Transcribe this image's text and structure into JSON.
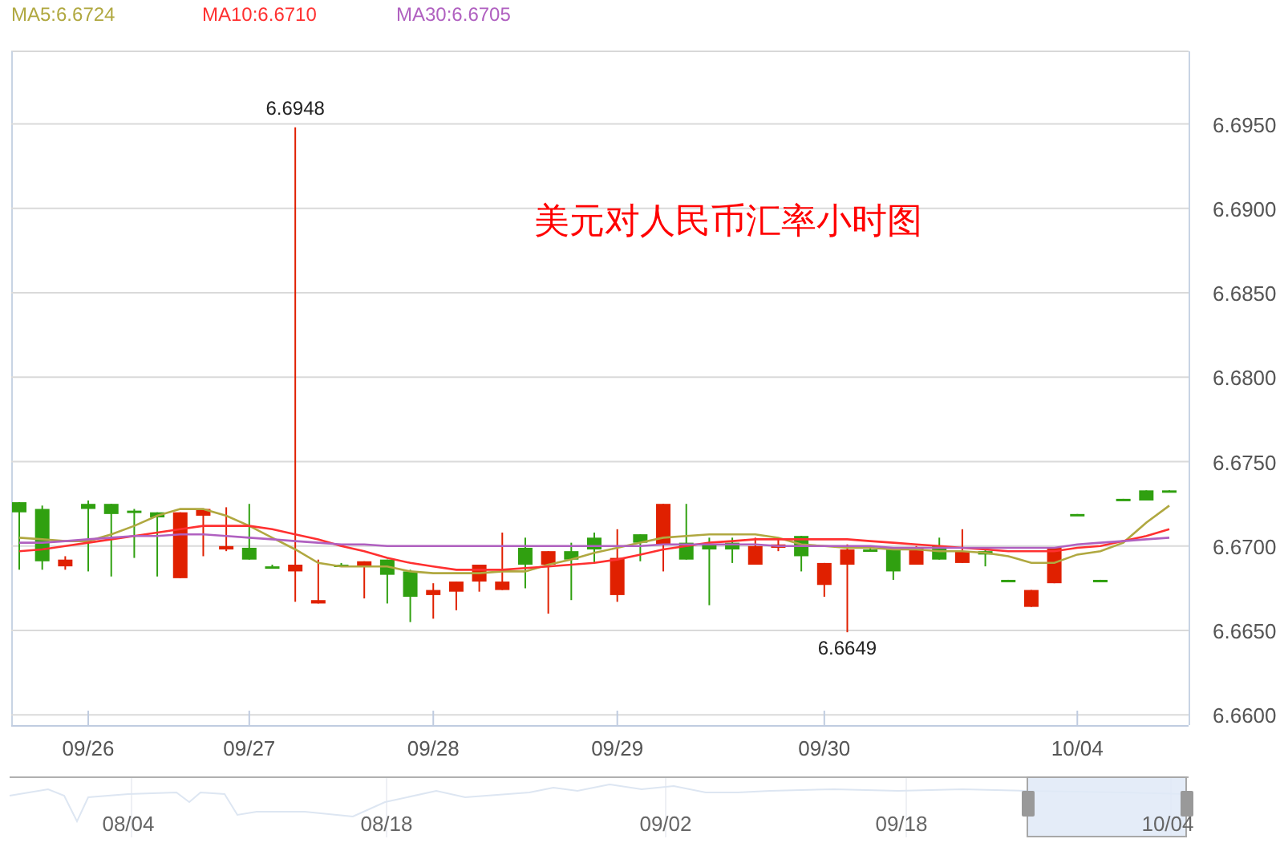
{
  "chart": {
    "chart_data": {
      "type": "candlestick",
      "grid": true,
      "title": "美元对人民币汇率小时图",
      "ylim": [
        6.6594,
        6.6993
      ],
      "yticks": [
        {
          "value": 6.66,
          "label": "6.6600"
        },
        {
          "value": 6.665,
          "label": "6.6650"
        },
        {
          "value": 6.67,
          "label": "6.6700"
        },
        {
          "value": 6.675,
          "label": "6.6750"
        },
        {
          "value": 6.68,
          "label": "6.6800"
        },
        {
          "value": 6.685,
          "label": "6.6850"
        },
        {
          "value": 6.69,
          "label": "6.6900"
        },
        {
          "value": 6.695,
          "label": "6.6950"
        }
      ],
      "categories": [
        null,
        null,
        null,
        "09/26",
        null,
        null,
        null,
        null,
        null,
        null,
        "09/27",
        null,
        null,
        null,
        null,
        null,
        null,
        null,
        "09/28",
        null,
        null,
        null,
        null,
        null,
        null,
        null,
        "09/29",
        null,
        null,
        null,
        null,
        null,
        null,
        null,
        null,
        "09/30",
        null,
        null,
        null,
        null,
        null,
        null,
        null,
        null,
        null,
        null,
        "10/04",
        null,
        null,
        null,
        null
      ],
      "ohlc": [
        [
          6.6726,
          6.6726,
          6.6686,
          6.672
        ],
        [
          6.6722,
          6.6724,
          6.6686,
          6.6691
        ],
        [
          6.6688,
          6.6694,
          6.6686,
          6.6692
        ],
        [
          6.6725,
          6.6727,
          6.6685,
          6.6722
        ],
        [
          6.6725,
          6.6725,
          6.6682,
          6.6719
        ],
        [
          6.6721,
          6.6722,
          6.6693,
          6.672
        ],
        [
          6.672,
          6.672,
          6.6682,
          6.6717
        ],
        [
          6.6681,
          6.672,
          6.6681,
          6.672
        ],
        [
          6.6718,
          6.6722,
          6.6694,
          6.6722
        ],
        [
          6.6698,
          6.6723,
          6.6697,
          6.67
        ],
        [
          6.6699,
          6.6725,
          6.6692,
          6.6692
        ],
        [
          6.6688,
          6.6689,
          6.6687,
          6.6687
        ],
        [
          6.6685,
          6.6948,
          6.6667,
          6.6689
        ],
        [
          6.6666,
          6.6692,
          6.6666,
          6.6668
        ],
        [
          6.6689,
          6.669,
          6.6688,
          6.6688
        ],
        [
          6.6688,
          6.6691,
          6.6669,
          6.6691
        ],
        [
          6.6692,
          6.6692,
          6.6666,
          6.6683
        ],
        [
          6.6685,
          6.6686,
          6.6655,
          6.667
        ],
        [
          6.6671,
          6.6678,
          6.6657,
          6.6674
        ],
        [
          6.6673,
          6.6679,
          6.6662,
          6.6679
        ],
        [
          6.6679,
          6.6689,
          6.6673,
          6.6689
        ],
        [
          6.6674,
          6.6708,
          6.6674,
          6.6679
        ],
        [
          6.6699,
          6.6705,
          6.6675,
          6.6689
        ],
        [
          6.6689,
          6.6697,
          6.666,
          6.6697
        ],
        [
          6.6697,
          6.6702,
          6.6668,
          6.6692
        ],
        [
          6.6705,
          6.6708,
          6.669,
          6.6698
        ],
        [
          6.6671,
          6.671,
          6.6667,
          6.6693
        ],
        [
          6.6707,
          6.6707,
          6.6691,
          6.6702
        ],
        [
          6.6701,
          6.6725,
          6.6685,
          6.6725
        ],
        [
          6.6702,
          6.6725,
          6.6692,
          6.6692
        ],
        [
          6.6701,
          6.6705,
          6.6665,
          6.6698
        ],
        [
          6.6702,
          6.6705,
          6.669,
          6.6698
        ],
        [
          6.6689,
          6.6705,
          6.6689,
          6.67
        ],
        [
          6.6699,
          6.6705,
          6.6697,
          6.6701
        ],
        [
          6.6706,
          6.6706,
          6.6685,
          6.6694
        ],
        [
          6.6677,
          6.669,
          6.667,
          6.669
        ],
        [
          6.6689,
          6.6701,
          6.6649,
          6.6698
        ],
        [
          6.6698,
          6.6699,
          6.6697,
          6.6697
        ],
        [
          6.6698,
          6.6698,
          6.668,
          6.6685
        ],
        [
          6.6689,
          6.67,
          6.6689,
          6.6699
        ],
        [
          6.67,
          6.6705,
          6.6692,
          6.6692
        ],
        [
          6.669,
          6.671,
          6.669,
          6.6697
        ],
        [
          6.6697,
          6.6698,
          6.6688,
          6.6695
        ],
        [
          6.668,
          6.668,
          6.668,
          6.668
        ],
        [
          6.6664,
          6.6674,
          6.6664,
          6.6674
        ],
        [
          6.6678,
          6.6699,
          6.6678,
          6.6699
        ],
        [
          6.6719,
          6.6719,
          6.6719,
          6.6719
        ],
        [
          6.668,
          6.668,
          6.668,
          6.668
        ],
        [
          6.6728,
          6.6728,
          6.6728,
          6.6728
        ],
        [
          6.6733,
          6.6733,
          6.6727,
          6.6727
        ],
        [
          6.6733,
          6.6733,
          6.6733,
          6.6733
        ]
      ],
      "series": [
        {
          "type": "line",
          "name": "MA5:6.6724",
          "color": "#b0a840",
          "values": [
            6.6705,
            6.6704,
            6.6703,
            6.6703,
            6.6707,
            6.6712,
            6.6718,
            6.6722,
            6.6722,
            6.6718,
            6.6712,
            6.6705,
            6.6698,
            6.669,
            6.6688,
            6.6688,
            6.6688,
            6.6685,
            6.6684,
            6.6684,
            6.6684,
            6.6685,
            6.6685,
            6.6689,
            6.6692,
            6.6696,
            6.6699,
            6.6702,
            6.6705,
            6.6706,
            6.6707,
            6.6707,
            6.6707,
            6.6705,
            6.6701,
            6.67,
            6.6699,
            6.6699,
            6.6698,
            6.6698,
            6.6697,
            6.6697,
            6.6696,
            6.6694,
            6.669,
            6.669,
            6.6695,
            6.6697,
            6.6702,
            6.6714,
            6.6724
          ]
        },
        {
          "type": "line",
          "name": "MA10:6.6710",
          "color": "#ff3030",
          "values": [
            6.6697,
            6.6698,
            6.67,
            6.6702,
            6.6704,
            6.6706,
            6.6708,
            6.671,
            6.6712,
            6.6712,
            6.6712,
            6.671,
            6.6707,
            6.6704,
            6.67,
            6.6697,
            6.6693,
            6.669,
            6.6688,
            6.6686,
            6.6686,
            6.6686,
            6.6687,
            6.6688,
            6.6689,
            6.669,
            6.6692,
            6.6695,
            6.6698,
            6.67,
            6.6702,
            6.6703,
            6.6704,
            6.6704,
            6.6704,
            6.6704,
            6.6704,
            6.6703,
            6.6702,
            6.6701,
            6.67,
            6.6699,
            6.6698,
            6.6697,
            6.6697,
            6.6697,
            6.6699,
            6.67,
            6.6703,
            6.6706,
            6.671
          ]
        },
        {
          "type": "line",
          "name": "MA30:6.6705",
          "color": "#b060c0",
          "values": [
            6.6702,
            6.6702,
            6.6703,
            6.6704,
            6.6705,
            6.6706,
            6.6706,
            6.6707,
            6.6707,
            6.6706,
            6.6705,
            6.6704,
            6.6703,
            6.6702,
            6.6701,
            6.6701,
            6.67,
            6.67,
            6.67,
            6.67,
            6.67,
            6.67,
            6.67,
            6.67,
            6.67,
            6.67,
            6.67,
            6.67,
            6.6701,
            6.6701,
            6.6701,
            6.6701,
            6.6701,
            6.67,
            6.67,
            6.67,
            6.67,
            6.67,
            6.6699,
            6.6699,
            6.6699,
            6.6699,
            6.6699,
            6.6699,
            6.6699,
            6.6699,
            6.6701,
            6.6702,
            6.6703,
            6.6704,
            6.6705
          ]
        }
      ],
      "annotations": [
        "6.6948",
        "6.6649"
      ]
    }
  },
  "navigator": {
    "labels": [
      "08/04",
      "08/18",
      "09/02",
      "09/18",
      "10/04"
    ]
  }
}
